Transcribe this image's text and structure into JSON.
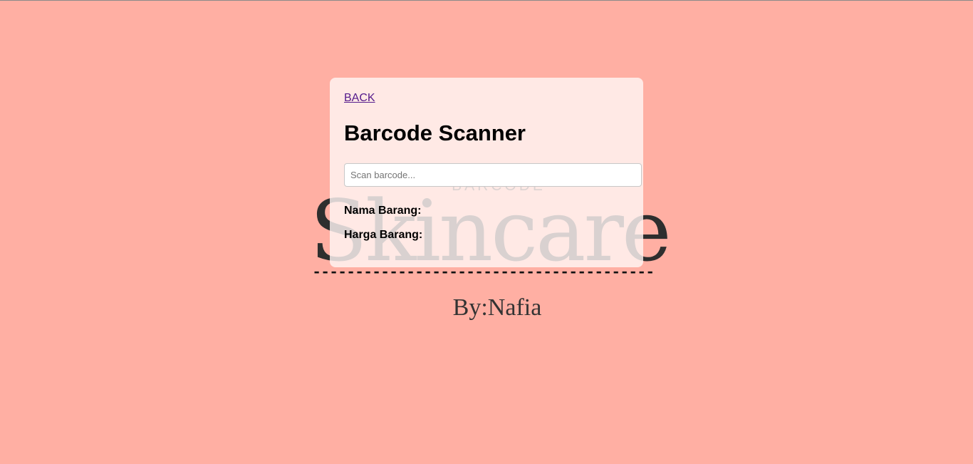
{
  "logo": {
    "top_text": "BARCODE",
    "main_text": "Skincare",
    "divider": "----------------------------------------",
    "byline": "By:Nafia"
  },
  "card": {
    "back_label": "BACK",
    "title": "Barcode Scanner",
    "search": {
      "placeholder": "Scan barcode...",
      "value": ""
    },
    "fields": {
      "name_label": "Nama Barang:",
      "name_value": "",
      "price_label": "Harga Barang:",
      "price_value": ""
    }
  },
  "colors": {
    "background": "#ffafa3",
    "card": "#fff0ee",
    "link": "#551a8b"
  }
}
